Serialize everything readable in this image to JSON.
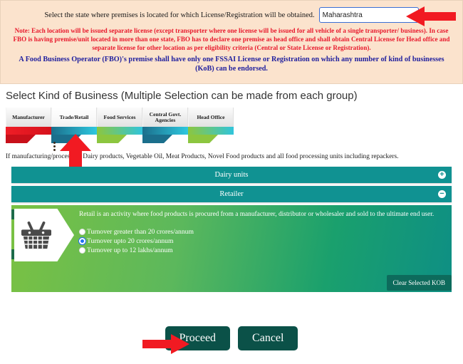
{
  "notice": {
    "state_prompt": "Select the state where premises is located for which License/Registration will be obtained.",
    "state_selected": "Maharashtra",
    "state_options": [
      "Maharashtra"
    ],
    "chevron_icon": "chevron-down-icon",
    "note_red": "Note: Each location will be issued separate license (except transporter where one license will be issued for all vehicle of a single transporter/ business). In case FBO is having premise/unit located in more than one state, FBO has to declare one premise as head office and shall obtain Central License for Head office and separate license for other location as per eligibility criteria (Central or State License or Registration).",
    "note_blue": "A Food Business Operator (FBO)'s premise shall have only one FSSAI License or Registration on which any number of kind of businesses (KoB) can be endorsed.",
    "colors": {
      "panel_bg": "#fbe3cd",
      "red": "#e8192c",
      "blue": "#1f1f9e",
      "select_border": "#3b6fd4"
    }
  },
  "heading": "Select Kind of Business (Multiple Selection can be made from each group)",
  "tabs": [
    {
      "label": "Manufacturer",
      "band_from": "#ef1d26",
      "band_to": "#c8101a",
      "active": false
    },
    {
      "label": "Trade/Retail",
      "band_from": "#1b6f8c",
      "band_to": "#2ec8df",
      "active": true
    },
    {
      "label": "Food Services",
      "band_from": "#8cc63f",
      "band_to": "#2ec8df",
      "active": false
    },
    {
      "label": "Central Govt. Agencies",
      "band_from": "#1b6f8c",
      "band_to": "#2ec8df",
      "active": false
    },
    {
      "label": "Head Office",
      "band_from": "#8cc63f",
      "band_to": "#2ec8df",
      "active": false
    }
  ],
  "tab_indicator_icon": "vertical-dots-icon",
  "sub_note": "If manufacturing/processing Dairy products, Vegetable Oil, Meat Products, Novel Food products and all food processing units including repackers.",
  "accordion": [
    {
      "title": "Dairy units",
      "expanded": false,
      "toggle_icon": "plus-circle-icon",
      "toggle_glyph": "+"
    },
    {
      "title": "Retailer",
      "expanded": true,
      "toggle_icon": "minus-circle-icon",
      "toggle_glyph": "−"
    }
  ],
  "panel": {
    "icon": "shopping-basket-icon",
    "description": "Retail is an activity where food products is procured from a manufacturer, distributor or wholesaler and sold to the ultimate end user.",
    "options": [
      {
        "label": "Turnover greater than 20 crores/annum",
        "selected": false
      },
      {
        "label": "Turnover upto 20 crores/annum",
        "selected": true
      },
      {
        "label": "Turnover up to 12 lakhs/annum",
        "selected": false
      }
    ],
    "clear_label": "Clear Selected KOB",
    "accent": "#109292",
    "green_from": "#7ac143",
    "green_to": "#0e8f84"
  },
  "footer": {
    "proceed_label": "Proceed",
    "cancel_label": "Cancel",
    "button_color": "#0b5148"
  },
  "annotations": {
    "arrow_color": "#f11a22",
    "arrow_state_dropdown": "left-pointing-arrow",
    "arrow_tab": "up-pointing-arrow",
    "arrow_proceed": "right-pointing-arrow"
  }
}
